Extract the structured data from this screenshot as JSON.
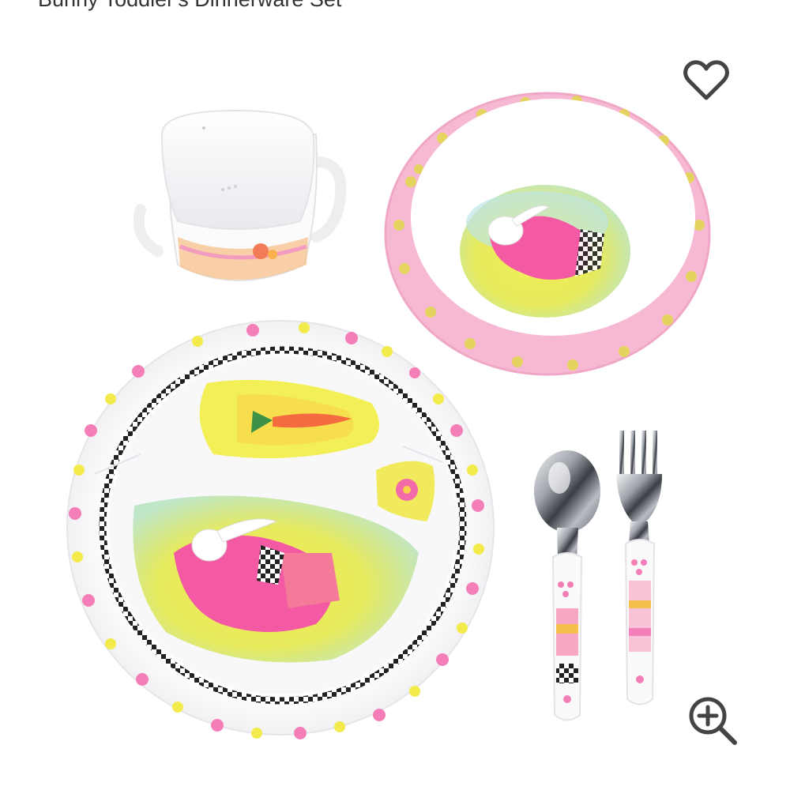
{
  "product": {
    "title": "Bunny Toddler's Dinnerware Set"
  },
  "image": {
    "alt": "Bunny Toddler's Dinnerware Set: sippy cup, bowl, divided plate, spoon and fork"
  },
  "actions": {
    "favorite_icon": "heart-outline-icon",
    "zoom_icon": "zoom-in-icon"
  },
  "colors": {
    "icon": "#444444",
    "pink_accent": "#f3a9c9",
    "yellow_accent": "#f2e84a"
  }
}
